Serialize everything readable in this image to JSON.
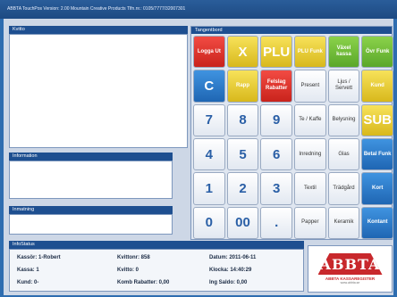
{
  "window": {
    "title": "ABBTA TouchPos  Version: 2.00    Mountain Creative Products    Tlfn.nr.: 0105/7777/32007301"
  },
  "receipt": {
    "header": "Kvitto"
  },
  "information": {
    "header": "Information"
  },
  "input": {
    "header": "Inmatning"
  },
  "keyboard": {
    "header": "Tangentbord",
    "keys": [
      {
        "label": "Logga Ut",
        "color": "red"
      },
      {
        "label": "X",
        "color": "yellow",
        "big": true
      },
      {
        "label": "PLU",
        "color": "yellow",
        "big": true
      },
      {
        "label": "PLU Funk",
        "color": "yellow"
      },
      {
        "label": "Växel kassa",
        "color": "green"
      },
      {
        "label": "Övr Funk",
        "color": "green"
      },
      {
        "label": "C",
        "color": "blue",
        "big": true
      },
      {
        "label": "Rapp",
        "color": "yellow"
      },
      {
        "label": "Felslag Rabatter",
        "color": "red"
      },
      {
        "label": "Present",
        "color": "white"
      },
      {
        "label": "Ljus / Servett",
        "color": "white"
      },
      {
        "label": "Kund",
        "color": "yellow"
      },
      {
        "label": "7",
        "color": "num"
      },
      {
        "label": "8",
        "color": "num"
      },
      {
        "label": "9",
        "color": "num"
      },
      {
        "label": "Te / Kaffe",
        "color": "white"
      },
      {
        "label": "Belysning",
        "color": "white"
      },
      {
        "label": "SUB",
        "color": "yellow",
        "big": true
      },
      {
        "label": "4",
        "color": "num"
      },
      {
        "label": "5",
        "color": "num"
      },
      {
        "label": "6",
        "color": "num"
      },
      {
        "label": "Inredning",
        "color": "white"
      },
      {
        "label": "Glas",
        "color": "white"
      },
      {
        "label": "Betal Funk",
        "color": "blue"
      },
      {
        "label": "1",
        "color": "num"
      },
      {
        "label": "2",
        "color": "num"
      },
      {
        "label": "3",
        "color": "num"
      },
      {
        "label": "Textil",
        "color": "white"
      },
      {
        "label": "Trädgård",
        "color": "white"
      },
      {
        "label": "Kort",
        "color": "blue"
      },
      {
        "label": "0",
        "color": "num"
      },
      {
        "label": "00",
        "color": "num"
      },
      {
        "label": ".",
        "color": "num"
      },
      {
        "label": "Papper",
        "color": "white"
      },
      {
        "label": "Keramik",
        "color": "white"
      },
      {
        "label": "Kontant",
        "color": "blue"
      }
    ]
  },
  "status": {
    "header": "InfoStatus",
    "cells": [
      "Kassör: 1-Robert",
      "Kvittonr: 858",
      "Datum: 2011-06-11",
      "Kassa: 1",
      "Kvitto: 0",
      "Klocka: 14:40:29",
      "Kund: 0-",
      "Komb Rabatter: 0,00",
      "Ing Saldo: 0,00"
    ]
  },
  "logo": {
    "mark": "ABBTA",
    "name": "ABBTA KASSAREGISTER",
    "sub": "www.abbta.se"
  },
  "colors": {
    "red": "#d9312a",
    "yellow": "#e8c634",
    "green": "#6fbd3a",
    "blue": "#2a7bd0"
  }
}
